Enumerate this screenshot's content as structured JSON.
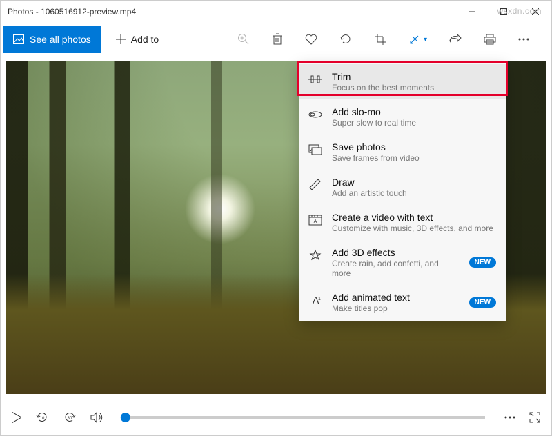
{
  "titlebar": {
    "title": "Photos - 1060516912-preview.mp4"
  },
  "toolbar": {
    "see_all_label": "See all photos",
    "add_to_label": "Add to"
  },
  "menu": {
    "items": [
      {
        "title": "Trim",
        "sub": "Focus on the best moments"
      },
      {
        "title": "Add slo-mo",
        "sub": "Super slow to real time"
      },
      {
        "title": "Save photos",
        "sub": "Save frames from video"
      },
      {
        "title": "Draw",
        "sub": "Add an artistic touch"
      },
      {
        "title": "Create a video with text",
        "sub": "Customize with music, 3D effects, and more"
      },
      {
        "title": "Add 3D effects",
        "sub": "Create rain, add confetti, and more",
        "badge": "NEW"
      },
      {
        "title": "Add animated text",
        "sub": "Make titles pop",
        "badge": "NEW"
      }
    ]
  },
  "watermark": "wsxdn.com"
}
